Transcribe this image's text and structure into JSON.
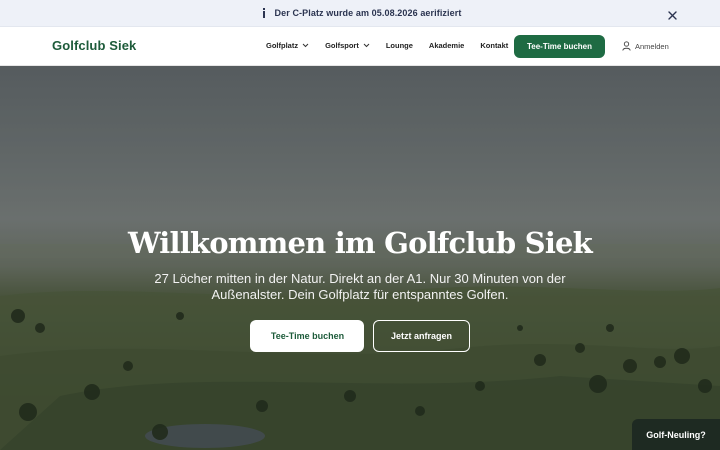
{
  "announcement": {
    "icon": "info-icon",
    "text": "Der C-Platz wurde am 05.08.2026 aerifiziert",
    "close_icon": "close-icon"
  },
  "header": {
    "logo": "Golfclub Siek",
    "nav": [
      {
        "label": "Golfplatz",
        "has_dropdown": true
      },
      {
        "label": "Golfsport",
        "has_dropdown": true
      },
      {
        "label": "Lounge",
        "has_dropdown": false
      },
      {
        "label": "Akademie",
        "has_dropdown": false
      },
      {
        "label": "Kontakt",
        "has_dropdown": false
      }
    ],
    "cta": "Tee-Time buchen",
    "login": {
      "label": "Anmelden",
      "icon": "user-icon"
    }
  },
  "hero": {
    "title": "Willkommen im Golfclub Siek",
    "subtitle": "27 Löcher mitten in der Natur. Direkt an der A1. Nur 30 Minuten von der Außenalster. Dein Golfplatz für entspanntes Golfen.",
    "primary_button": {
      "icon_glyph": "",
      "label": "Tee-Time buchen"
    },
    "secondary_button": "Jetzt anfragen"
  },
  "floating_button": "Golf-Neuling?",
  "colors": {
    "brand_green": "#1e6b43",
    "logo_green": "#1d5b3a",
    "announcement_bg": "#eef1f8",
    "floating_bg": "#1e2a22"
  }
}
